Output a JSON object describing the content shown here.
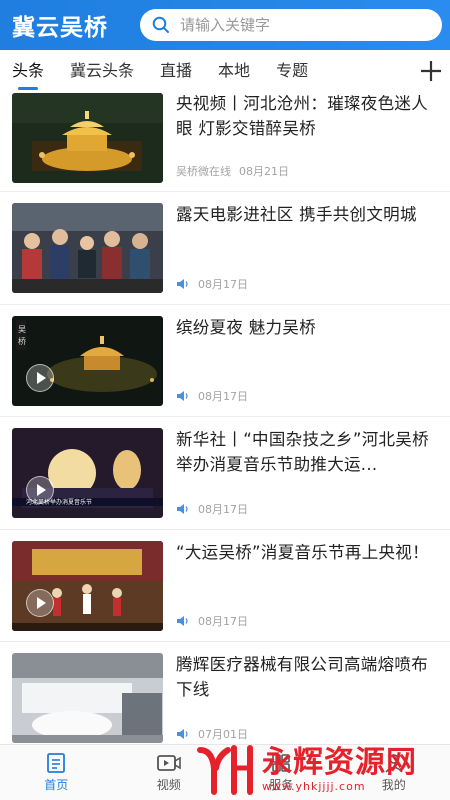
{
  "header": {
    "app_title": "冀云吴桥",
    "search_placeholder": "请输入关键字"
  },
  "tabs": [
    {
      "label": "头条",
      "active": true
    },
    {
      "label": "冀云头条",
      "active": false
    },
    {
      "label": "直播",
      "active": false
    },
    {
      "label": "本地",
      "active": false
    },
    {
      "label": "专题",
      "active": false
    }
  ],
  "news": [
    {
      "title": "央视频丨河北沧州：璀璨夜色迷人眼 灯影交错醉吴桥",
      "source": "吴桥微在线",
      "date": "08月21日",
      "audio": false,
      "video": false
    },
    {
      "title": "露天电影进社区 携手共创文明城",
      "source": "",
      "date": "08月17日",
      "audio": true,
      "video": false
    },
    {
      "title": "缤纷夏夜 魅力吴桥",
      "source": "",
      "date": "08月17日",
      "audio": true,
      "video": true
    },
    {
      "title": "新华社丨“中国杂技之乡”河北吴桥举办消夏音乐节助推大运...",
      "source": "",
      "date": "08月17日",
      "audio": true,
      "video": true
    },
    {
      "title": "“大运吴桥”消夏音乐节再上央视！",
      "source": "",
      "date": "08月17日",
      "audio": true,
      "video": true
    },
    {
      "title": "腾辉医疗器械有限公司高端熔喷布下线",
      "source": "",
      "date": "07月01日",
      "audio": true,
      "video": false
    }
  ],
  "bottom_nav": [
    {
      "label": "首页",
      "icon": "home-icon",
      "active": true
    },
    {
      "label": "视频",
      "icon": "video-icon",
      "active": false
    },
    {
      "label": "服务",
      "icon": "service-icon",
      "active": false
    },
    {
      "label": "我的",
      "icon": "user-icon",
      "active": false
    }
  ],
  "watermark": {
    "text": "永辉资源网",
    "url": "www.yhkjjjj.com"
  },
  "colors": {
    "accent": "#1f7ee0",
    "watermark": "#e5222b"
  }
}
